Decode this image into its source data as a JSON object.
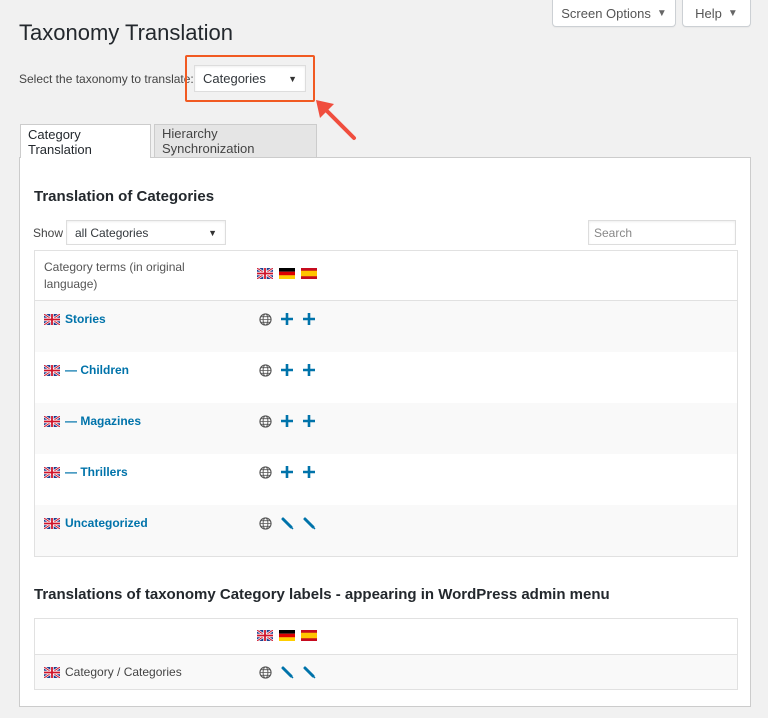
{
  "header": {
    "screen_options_label": "Screen Options",
    "help_label": "Help",
    "page_title": "Taxonomy Translation"
  },
  "taxonomy_selector": {
    "label": "Select the taxonomy to translate:",
    "selected": "Categories"
  },
  "tabs": [
    {
      "label": "Category Translation",
      "active": true
    },
    {
      "label": "Hierarchy Synchronization",
      "active": false
    }
  ],
  "translation_section": {
    "title": "Translation of Categories",
    "show_label": "Show",
    "filter_selected": "all Categories",
    "search_placeholder": "Search",
    "column_header": "Category terms (in original language)",
    "languages": [
      "en",
      "de",
      "es"
    ],
    "terms": [
      {
        "name": "Stories",
        "actions": [
          "globe",
          "add",
          "add"
        ]
      },
      {
        "name": "— Children",
        "actions": [
          "globe",
          "add",
          "add"
        ]
      },
      {
        "name": "— Magazines",
        "actions": [
          "globe",
          "add",
          "add"
        ]
      },
      {
        "name": "— Thrillers",
        "actions": [
          "globe",
          "add",
          "add"
        ]
      },
      {
        "name": "Uncategorized",
        "actions": [
          "globe",
          "edit",
          "edit"
        ]
      }
    ]
  },
  "labels_section": {
    "title": "Translations of taxonomy Category labels - appearing in WordPress admin menu",
    "row_label": "Category / Categories",
    "actions": [
      "globe",
      "edit",
      "edit"
    ]
  },
  "colors": {
    "link": "#0073aa",
    "highlight": "#f15a22",
    "icon": "#0073aa"
  }
}
